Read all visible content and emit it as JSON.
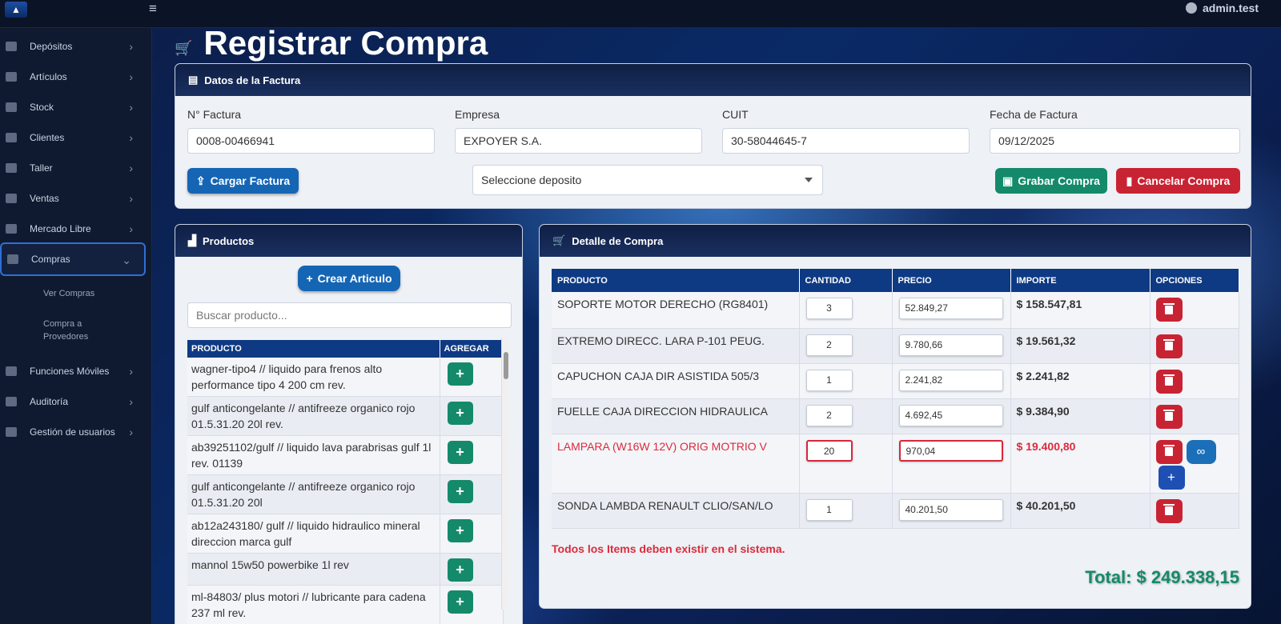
{
  "header": {
    "user": "admin.test"
  },
  "sidebar": {
    "items": [
      {
        "label": "Depósitos"
      },
      {
        "label": "Artículos"
      },
      {
        "label": "Stock"
      },
      {
        "label": "Clientes"
      },
      {
        "label": "Taller"
      },
      {
        "label": "Ventas"
      },
      {
        "label": "Mercado Libre"
      },
      {
        "label": "Compras"
      },
      {
        "label": "Funciones Móviles"
      },
      {
        "label": "Auditoría"
      },
      {
        "label": "Gestión de usuarios"
      }
    ],
    "sub_items": [
      {
        "label": "Ver Compras"
      },
      {
        "label": "Compra a Provedores"
      }
    ]
  },
  "page": {
    "title": "Registrar Compra"
  },
  "invoice": {
    "header": "Datos de la Factura",
    "fields": {
      "numero_label": "N° Factura",
      "numero_value": "0008-00466941",
      "empresa_label": "Empresa",
      "empresa_value": "EXPOYER S.A.",
      "cuit_label": "CUIT",
      "cuit_value": "30-58044645-7",
      "fecha_label": "Fecha de Factura",
      "fecha_value": "09/12/2025"
    },
    "cargar_label": "Cargar Factura",
    "deposito_placeholder": "Seleccione deposito",
    "grabar_label": "Grabar Compra",
    "cancelar_label": "Cancelar Compra"
  },
  "products": {
    "header": "Productos",
    "crear_label": "Crear Articulo",
    "search_placeholder": "Buscar producto...",
    "columns": [
      "PRODUCTO",
      "AGREGAR"
    ],
    "rows": [
      {
        "name": "wagner-tipo4 // liquido para frenos alto performance tipo 4 200 cm rev."
      },
      {
        "name": "gulf anticongelante // antifreeze organico rojo 01.5.31.20 20l rev."
      },
      {
        "name": "ab39251102/gulf // liquido lava parabrisas gulf 1l rev. 01139"
      },
      {
        "name": "gulf anticongelante // antifreeze organico rojo 01.5.31.20 20l"
      },
      {
        "name": "ab12a243180/ gulf // liquido hidraulico mineral direccion marca gulf"
      },
      {
        "name": "mannol 15w50 powerbike 1l rev"
      },
      {
        "name": "ml-84803/ plus motori // lubricante para cadena 237 ml rev."
      }
    ]
  },
  "detail": {
    "header": "Detalle de Compra",
    "columns": [
      "PRODUCTO",
      "CANTIDAD",
      "PRECIO",
      "IMPORTE",
      "OPCIONES"
    ],
    "rows": [
      {
        "producto": "SOPORTE MOTOR DERECHO (RG8401)",
        "cantidad": "3",
        "precio": "52.849,27",
        "importe": "$ 158.547,81"
      },
      {
        "producto": "EXTREMO DIRECC. LARA P-101 PEUG.",
        "cantidad": "2",
        "precio": "9.780,66",
        "importe": "$ 19.561,32"
      },
      {
        "producto": "CAPUCHON CAJA DIR ASISTIDA 505/3",
        "cantidad": "1",
        "precio": "2.241,82",
        "importe": "$ 2.241,82"
      },
      {
        "producto": "FUELLE CAJA DIRECCION HIDRAULICA",
        "cantidad": "2",
        "precio": "4.692,45",
        "importe": "$ 9.384,90"
      },
      {
        "producto": "LAMPARA (W16W 12V) ORIG MOTRIO V",
        "cantidad": "20",
        "precio": "970,04",
        "importe": "$ 19.400,80"
      },
      {
        "producto": "SONDA LAMBDA RENAULT CLIO/SAN/LO",
        "cantidad": "1",
        "precio": "40.201,50",
        "importe": "$ 40.201,50"
      }
    ],
    "warning": "Todos los Items deben existir en el sistema.",
    "total": "Total: $ 249.338,15"
  },
  "colors": {
    "primary": "#0e3a84",
    "success": "#148a6b",
    "danger": "#c82333",
    "error_text": "#dc2b3c"
  }
}
